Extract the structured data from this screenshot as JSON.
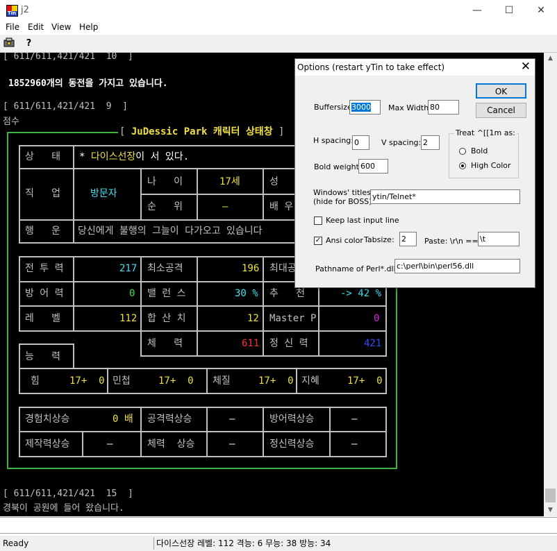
{
  "window": {
    "title": "j2",
    "icon": "ytin-icon",
    "icon_text": "Tin"
  },
  "menu": {
    "file": "File",
    "edit": "Edit",
    "view": "View",
    "help": "Help"
  },
  "toolbar": {
    "options_icon": "options-icon",
    "help_icon": "help-icon",
    "help_glyph": "?"
  },
  "terminal": {
    "prompt1": "[ 611/611,421/421  10  ]",
    "money_amount": "1852960",
    "money_text": "개의 동전을 가지고 있습니다.",
    "prompt2": "[ 611/611,421/421  9  ]",
    "line_score": "점수",
    "box_title_prefix": "[ ",
    "box_title": "JuDessic Park 캐릭터 상태창",
    "box_title_suffix": " ]",
    "status_label": "상   태",
    "status_star": "* ",
    "status_name": "다이스선장",
    "status_text": "이 서 있다.",
    "job_label": "직   업",
    "job_value": "방문자",
    "age_label": "나   이",
    "age_value": "17세",
    "sex_label": "성",
    "rank_label": "순   위",
    "rank_value": "—",
    "spouse_label": "배 우",
    "luck_label": "행   운",
    "luck_text": "당신에게 불행의 그늘이 다가오고 있습니다",
    "combat_label": "전 투 력",
    "combat_value": "217",
    "min_attack_label": "최소공격",
    "min_attack_value": "196",
    "max_attack_label": "최대공",
    "defense_label": "방 어 력",
    "defense_value": "0",
    "balance_label": "밸 런 스",
    "balance_value": "30 %",
    "recommend_label": "추   천",
    "recommend_value": "-> 42 %",
    "level_label": "레   벨",
    "level_value": "112",
    "total_label": "합 산 치",
    "total_value": "12",
    "master_label": "Master P",
    "master_value": "0",
    "hp_label": "체   력",
    "hp_value": "611",
    "mp_label": "정 신 력",
    "mp_value": "421",
    "ability_label": "능   력",
    "str_label": "힘",
    "str_value": "17+  0",
    "dex_label": "민첩",
    "dex_value": "17+  0",
    "con_label": "체질",
    "con_value": "17+  0",
    "wis_label": "지혜",
    "wis_value": "17+  0",
    "exp_up_label": "경험치상승",
    "exp_up_value": "0 배",
    "atk_up_label": "공격력상승",
    "atk_up_value": "—",
    "def_up_label": "방어력상승",
    "def_up_value": "—",
    "craft_up_label": "제작력상승",
    "craft_up_value": "—",
    "hp_up_label": "체력  상승",
    "hp_up_value": "—",
    "mp_up_label": "정신력상승",
    "mp_up_value": "—",
    "prompt3": "[ 611/611,421/421  15  ]",
    "last_line": "경북이 공원에 들어 왔습니다."
  },
  "status_bar": {
    "ready": "Ready",
    "info": "다이스선장  레벨: 112 격능: 6 무능: 38 방능: 34"
  },
  "dialog": {
    "title": "Options (restart yTin to take effect)",
    "close": "✕",
    "buffersize_label": "Buffersize",
    "buffersize_value": "3000",
    "maxwidth_label": "Max Width",
    "maxwidth_value": "80",
    "ok": "OK",
    "cancel": "Cancel",
    "hspacing_label": "H spacing:",
    "hspacing_value": "0",
    "vspacing_label": "V spacing:",
    "vspacing_value": "2",
    "treat_label": "Treat ^[[1m as:",
    "bold_option": "Bold",
    "highcolor_option": "High Color",
    "selected_treat": "High Color",
    "boldweight_label": "Bold weight:",
    "boldweight_value": "600",
    "wintitles_label1": "Windows' titles:",
    "wintitles_label2": "(hide for BOSS)",
    "wintitles_value": "ytin/Telnet*",
    "keep_last_label": "Keep last input line",
    "keep_last_checked": false,
    "ansi_label": "Ansi color",
    "ansi_checked": true,
    "tabsize_label": "Tabsize:",
    "tabsize_value": "2",
    "paste_label": "Paste: \\r\\n ==>",
    "paste_value": "\\t",
    "perl_label": "Pathname of Perl*.dll:",
    "perl_value": "c:\\perl\\bin\\perl56.dll"
  },
  "colors": {
    "terminal_bg": "#000000",
    "gray_text": "#c0c0c0",
    "white_text": "#ffffff",
    "yellow": "#f0e040",
    "cyan": "#40e0f0",
    "green_border": "#3fb13f",
    "red": "#ff3030",
    "blue": "#3050ff",
    "magenta": "#e020e0"
  }
}
